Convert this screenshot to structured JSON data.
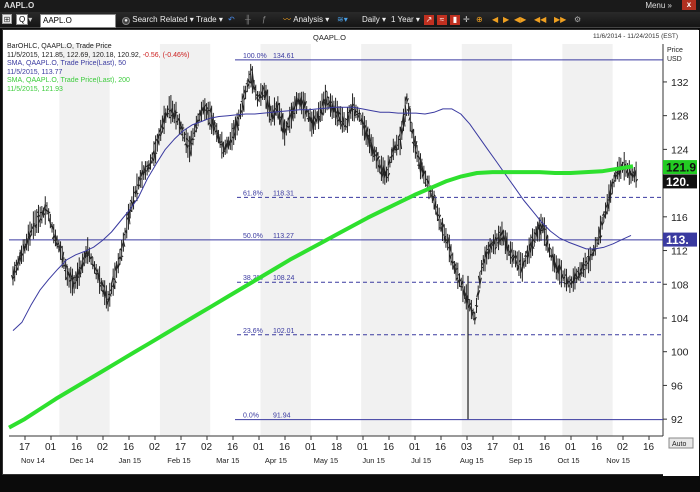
{
  "window": {
    "title": "AAPL.O",
    "menu_label": "Menu »",
    "close_label": "x"
  },
  "toolbar": {
    "ticker_type": "Q",
    "symbol": "AAPL.O",
    "search_label": "Search",
    "related_label": "Related ▾",
    "trade_label": "Trade ▾",
    "analysis_label": "Analysis ▾",
    "interval_label": "Daily ▾",
    "range_label": "1 Year ▾",
    "accent_color": "#f0a020"
  },
  "header": {
    "instrument": "QAAPL.O",
    "date_range": "11/6/2014 - 11/24/2015 (EST)",
    "price_label": "Price",
    "currency_label": "USD",
    "auto_label": "Auto"
  },
  "legend": {
    "line1": "BarOHLC, QAAPL.O, Trade Price",
    "line2_values": "11/5/2015, 121.85, 122.69, 120.18, 120.92,",
    "line2_change": "-0.56, (-0.46%)",
    "line3": "SMA, QAAPL.O, Trade Price(Last),  50",
    "line4": "11/5/2015, 113.77",
    "line5": "SMA, QAAPL.O, Trade Price(Last),  200",
    "line6": "11/5/2015, 121.93"
  },
  "price_tags": {
    "sma200": "121.9",
    "last": "120.",
    "sma50": "113.",
    "sma200_color": "#22cc22",
    "last_color": "#111111",
    "sma50_color": "#3a3aa0"
  },
  "chart_data": {
    "type": "line",
    "title": "QAAPL.O",
    "ylabel": "Price USD",
    "ylim": [
      90,
      136.5
    ],
    "y_ticks": [
      92,
      96,
      100,
      104,
      108,
      112,
      116,
      120,
      124,
      128,
      132
    ],
    "x_day_labels": [
      "17",
      "01",
      "16",
      "02",
      "16",
      "02",
      "17",
      "02",
      "16",
      "01",
      "16",
      "01",
      "18",
      "01",
      "16",
      "01",
      "16",
      "03",
      "17",
      "01",
      "16",
      "01",
      "16",
      "02",
      "16"
    ],
    "x_month_labels": [
      "Nov 14",
      "Dec 14",
      "Jan 15",
      "Feb 15",
      "Mar 15",
      "Apr 15",
      "May 15",
      "Jun 15",
      "Jul 15",
      "Aug 15",
      "Sep 15",
      "Oct 15",
      "Nov 15"
    ],
    "fibonacci": [
      {
        "pct": "100.0%",
        "value": 134.61
      },
      {
        "pct": "61.8%",
        "value": 118.31
      },
      {
        "pct": "50.0%",
        "value": 113.27
      },
      {
        "pct": "38.2%",
        "value": 108.24
      },
      {
        "pct": "23.6%",
        "value": 102.01
      },
      {
        "pct": "0.0%",
        "value": 91.94
      }
    ],
    "series": [
      {
        "name": "BarOHLC, QAAPL.O, Trade Price",
        "color": "#222222",
        "values": [
          109,
          111,
          113,
          115,
          116,
          117,
          114,
          112,
          109,
          108,
          110,
          112,
          110,
          108,
          106,
          109,
          112,
          116,
          119,
          121,
          122,
          124,
          127,
          129,
          128,
          126,
          124,
          127,
          129,
          128,
          126,
          124,
          125,
          127,
          130,
          133,
          130,
          131,
          128,
          129,
          126,
          128,
          130,
          129,
          127,
          128,
          130,
          129,
          128,
          127,
          129,
          128,
          126,
          124,
          122,
          121,
          124,
          125,
          130,
          125,
          122,
          120,
          118,
          115,
          113,
          110,
          108,
          106,
          104,
          110,
          112,
          113,
          114,
          112,
          111,
          110,
          112,
          114,
          115,
          112,
          110,
          109,
          108,
          109,
          110,
          111,
          113,
          116,
          119,
          121.5,
          122,
          121
        ]
      },
      {
        "name": "SMA, QAAPL.O, Trade Price(Last), 50",
        "color": "#3a3aa0",
        "values": [
          102.5,
          103.5,
          105.5,
          107.3,
          108.6,
          109.8,
          110.9,
          111.5,
          111.9,
          112.4,
          113.2,
          114.2,
          115.5,
          116.8,
          118.3,
          120.5,
          122.3,
          124.0,
          125.2,
          126.2,
          126.9,
          127.3,
          127.7,
          127.9,
          128.0,
          128.1,
          128.2,
          128.2,
          128.3,
          128.4,
          128.5,
          128.6,
          128.7,
          128.7,
          128.8,
          128.9,
          129.0,
          129.0,
          129.0,
          128.8,
          128.6,
          128.4,
          128.4,
          128.3,
          128.3,
          128.3,
          128.2,
          128.4,
          128.8,
          128.8,
          128.2,
          127.0,
          125.5,
          124.0,
          122.5,
          121.0,
          119.5,
          118.0,
          116.7,
          115.4,
          114.3,
          113.5,
          113.0,
          112.6,
          112.2,
          112.2,
          112.4,
          112.8,
          113.3,
          113.8
        ]
      },
      {
        "name": "SMA, QAAPL.O, Trade Price(Last), 200",
        "color": "#2ee02e",
        "values": [
          91.0,
          92.0,
          93.2,
          94.4,
          95.5,
          96.6,
          97.7,
          98.8,
          99.9,
          101.0,
          102.1,
          103.2,
          104.3,
          105.4,
          106.5,
          107.6,
          108.7,
          109.8,
          110.9,
          111.9,
          112.9,
          113.9,
          114.9,
          115.9,
          116.8,
          117.7,
          118.6,
          119.4,
          120.2,
          120.8,
          121.2,
          121.3,
          121.3,
          121.3,
          121.3,
          121.2,
          121.2,
          121.3,
          121.4,
          121.7,
          122.0
        ]
      }
    ]
  }
}
